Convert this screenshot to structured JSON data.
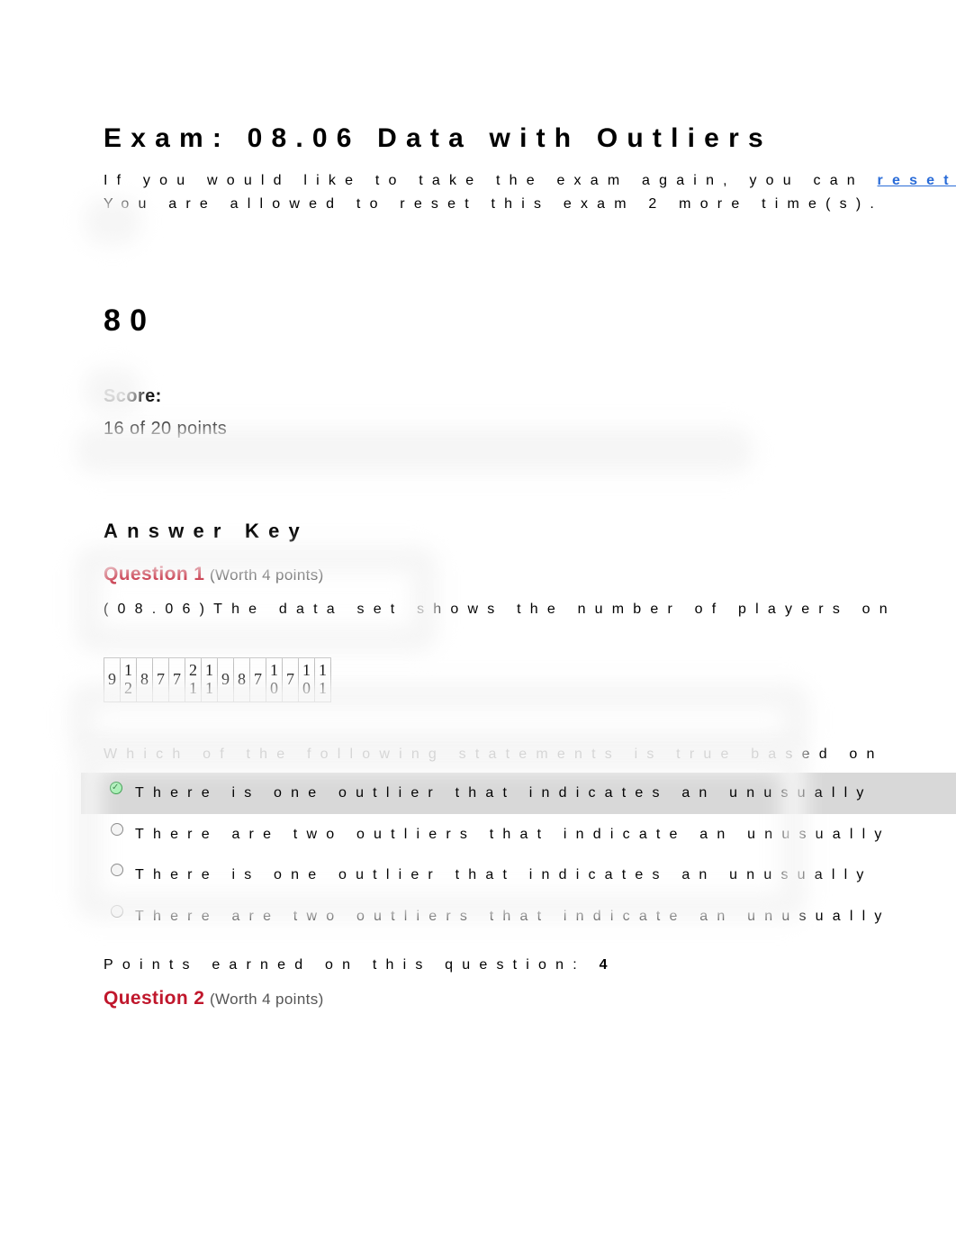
{
  "title": "Exam: 08.06 Data with Outliers",
  "intro": {
    "prefix": "If you would like to take the exam again, you can ",
    "link": "reset the exam now",
    "suffix": ".",
    "resets": "You are allowed to reset this exam 2 more time(s)."
  },
  "score_percent": "80",
  "score_label": "Score:",
  "score_text": "16 of 20 points",
  "answer_key": "Answer Key",
  "q1": {
    "num": "Question 1",
    "worth": "(Worth 4 points)",
    "prompt": "(08.06)The data set shows the number of players on",
    "data": [
      "9",
      "12",
      "8",
      "7",
      "7",
      "21",
      "11",
      "9",
      "8",
      "7",
      "10",
      "7",
      "10",
      "11"
    ],
    "which": "Which of the following statements is true based on",
    "answers": [
      "There is one outlier that indicates an unusually",
      "There are two outliers that indicate an unusually",
      "There is one outlier that indicates an unusually",
      "There are two outliers that indicate an unusually"
    ],
    "selected": 0,
    "points_label": "Points earned on this question:",
    "points": "4"
  },
  "q2": {
    "num": "Question 2",
    "worth": "(Worth 4 points)"
  }
}
